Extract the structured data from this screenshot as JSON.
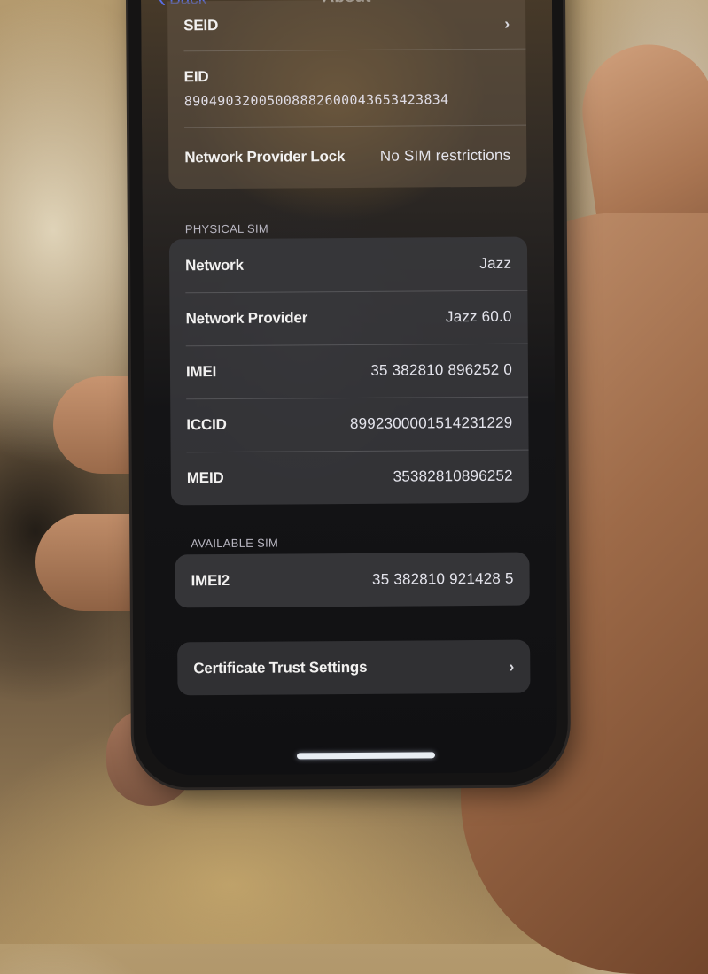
{
  "nav": {
    "back_label": "Back",
    "title": "About"
  },
  "top_group": {
    "seid": {
      "label": "SEID",
      "chevron": "chevron-right"
    },
    "eid": {
      "label": "EID",
      "value": "89049032005008882600043653423834"
    },
    "network_provider_lock": {
      "label": "Network Provider Lock",
      "value": "No SIM restrictions"
    }
  },
  "physical_sim": {
    "header": "PHYSICAL SIM",
    "rows": [
      {
        "label": "Network",
        "value": "Jazz"
      },
      {
        "label": "Network Provider",
        "value": "Jazz 60.0"
      },
      {
        "label": "IMEI",
        "value": "35 382810 896252 0"
      },
      {
        "label": "ICCID",
        "value": "8992300001514231229"
      },
      {
        "label": "MEID",
        "value": "35382810896252"
      }
    ]
  },
  "available_sim": {
    "header": "AVAILABLE SIM",
    "rows": [
      {
        "label": "IMEI2",
        "value": "35 382810 921428 5"
      }
    ]
  },
  "certificate_trust_settings": {
    "label": "Certificate Trust Settings",
    "chevron": "chevron-right"
  },
  "colors": {
    "accent_link": "#5a6fe6",
    "cell_background": "#3a3a3e",
    "text_primary": "#f2f1f0",
    "section_header": "#b9b7c2"
  }
}
